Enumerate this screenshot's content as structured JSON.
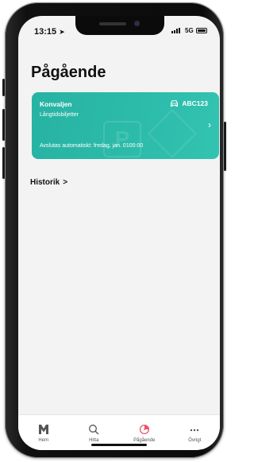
{
  "status_bar": {
    "time": "13:15",
    "network": "5G"
  },
  "page": {
    "title": "Pågående"
  },
  "parking_card": {
    "zone_name": "Konvaljen",
    "ticket_type": "Långtidsbiljetter",
    "license_plate": "ABC123",
    "ends_text": "Avslutas automatiskt: fredag, jan. 0100:00",
    "background_letter": "P",
    "color": "#2bb9a8",
    "car_icon": "car-icon",
    "chevron_icon": "chevron-right-icon"
  },
  "history": {
    "label": "Historik",
    "chevron": ">"
  },
  "tabbar": {
    "tabs": [
      {
        "label": "Hem",
        "icon": "m-logo-icon"
      },
      {
        "label": "Hitta",
        "icon": "search-icon"
      },
      {
        "label": "Pågående",
        "icon": "clock-icon",
        "active": true,
        "active_color": "#e8566a"
      },
      {
        "label": "Övrigt",
        "icon": "more-icon"
      }
    ]
  }
}
